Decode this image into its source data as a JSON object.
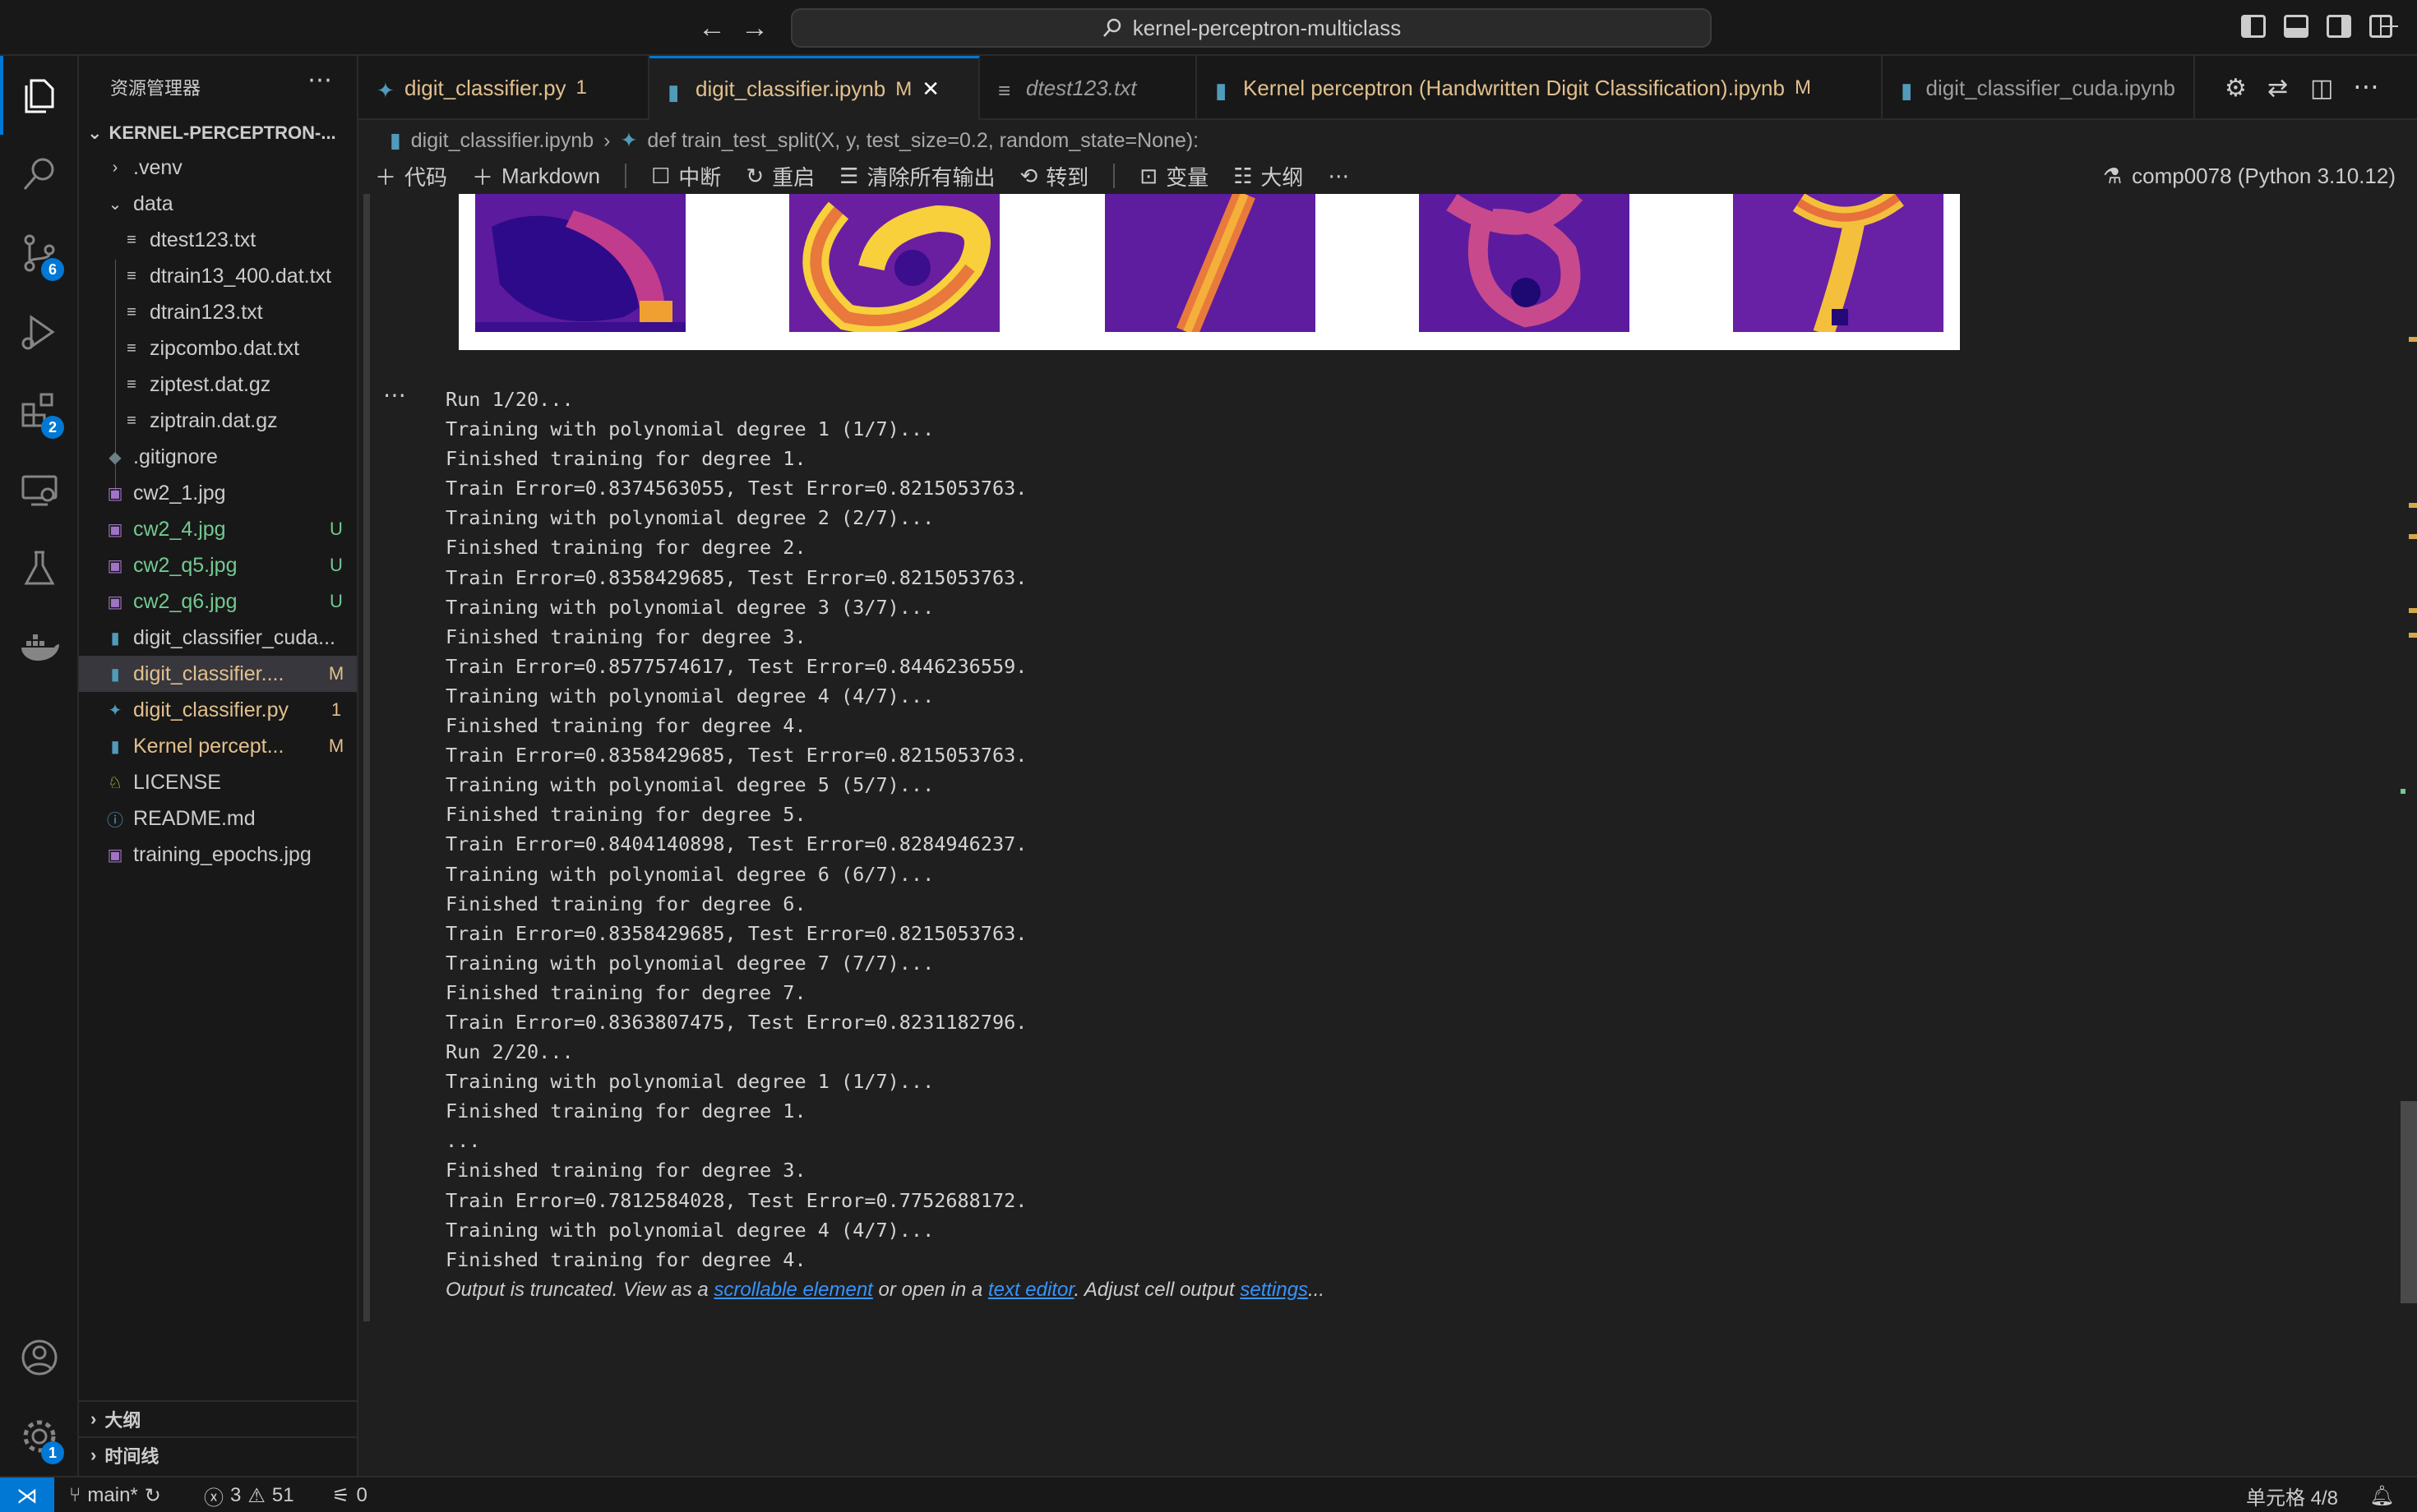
{
  "titlebar": {
    "search_text": "kernel-perceptron-multiclass",
    "back_icon": "arrow-left-icon",
    "forward_icon": "arrow-right-icon"
  },
  "activity": {
    "badges": {
      "scm": "6",
      "extensions": "2",
      "settings": "1"
    }
  },
  "sidebar": {
    "title": "资源管理器",
    "root": "KERNEL-PERCEPTRON-...",
    "items": [
      {
        "label": ".venv",
        "status": ""
      },
      {
        "label": "data",
        "status": ""
      },
      {
        "label": "dtest123.txt",
        "status": ""
      },
      {
        "label": "dtrain13_400.dat.txt",
        "status": ""
      },
      {
        "label": "dtrain123.txt",
        "status": ""
      },
      {
        "label": "zipcombo.dat.txt",
        "status": ""
      },
      {
        "label": "ziptest.dat.gz",
        "status": ""
      },
      {
        "label": "ziptrain.dat.gz",
        "status": ""
      },
      {
        "label": ".gitignore",
        "status": ""
      },
      {
        "label": "cw2_1.jpg",
        "status": ""
      },
      {
        "label": "cw2_4.jpg",
        "status": "U"
      },
      {
        "label": "cw2_q5.jpg",
        "status": "U"
      },
      {
        "label": "cw2_q6.jpg",
        "status": "U"
      },
      {
        "label": "digit_classifier_cuda...",
        "status": ""
      },
      {
        "label": "digit_classifier....",
        "status": "M"
      },
      {
        "label": "digit_classifier.py",
        "status": "1"
      },
      {
        "label": "Kernel percept...",
        "status": "M"
      },
      {
        "label": "LICENSE",
        "status": ""
      },
      {
        "label": "README.md",
        "status": ""
      },
      {
        "label": "training_epochs.jpg",
        "status": ""
      }
    ],
    "outline": "大纲",
    "timeline": "时间线"
  },
  "tabs": [
    {
      "label": "digit_classifier.py",
      "mod": "1"
    },
    {
      "label": "digit_classifier.ipynb",
      "mod": "M"
    },
    {
      "label": "dtest123.txt",
      "mod": ""
    },
    {
      "label": "Kernel perceptron (Handwritten Digit Classification).ipynb",
      "mod": "M"
    },
    {
      "label": "digit_classifier_cuda.ipynb",
      "mod": ""
    }
  ],
  "breadcrumb": {
    "file": "digit_classifier.ipynb",
    "symbol": "def train_test_split(X, y, test_size=0.2, random_state=None):"
  },
  "toolbar": {
    "code": "代码",
    "markdown": "Markdown",
    "interrupt": "中断",
    "restart": "重启",
    "clear": "清除所有输出",
    "goto": "转到",
    "variables": "变量",
    "outline": "大纲",
    "more": "⋯",
    "kernel": "comp0078 (Python 3.10.12)"
  },
  "output": {
    "lines": [
      "Run 1/20...",
      "Training with polynomial degree 1 (1/7)...",
      "Finished training for degree 1.",
      "Train Error=0.8374563055, Test Error=0.8215053763.",
      "Training with polynomial degree 2 (2/7)...",
      "Finished training for degree 2.",
      "Train Error=0.8358429685, Test Error=0.8215053763.",
      "Training with polynomial degree 3 (3/7)...",
      "Finished training for degree 3.",
      "Train Error=0.8577574617, Test Error=0.8446236559.",
      "Training with polynomial degree 4 (4/7)...",
      "Finished training for degree 4.",
      "Train Error=0.8358429685, Test Error=0.8215053763.",
      "Training with polynomial degree 5 (5/7)...",
      "Finished training for degree 5.",
      "Train Error=0.8404140898, Test Error=0.8284946237.",
      "Training with polynomial degree 6 (6/7)...",
      "Finished training for degree 6.",
      "Train Error=0.8358429685, Test Error=0.8215053763.",
      "Training with polynomial degree 7 (7/7)...",
      "Finished training for degree 7.",
      "Train Error=0.8363807475, Test Error=0.8231182796.",
      "Run 2/20...",
      "Training with polynomial degree 1 (1/7)...",
      "Finished training for degree 1.",
      "...",
      "Finished training for degree 3.",
      "Train Error=0.7812584028, Test Error=0.7752688172.",
      "Training with polynomial degree 4 (4/7)...",
      "Finished training for degree 4."
    ],
    "truncated_pre": "Output is truncated. View as a ",
    "truncated_link1": "scrollable element",
    "truncated_mid": " or open in a ",
    "truncated_link2": "text editor",
    "truncated_mid2": ". Adjust cell output ",
    "truncated_link3": "settings",
    "truncated_post": "..."
  },
  "statusbar": {
    "branch": "main*",
    "errors": "3",
    "warnings": "51",
    "ports": "0",
    "cell": "单元格 4/8"
  },
  "colors": {
    "accent": "#0078d4",
    "git_untracked": "#73c991",
    "git_modified": "#e2c08d",
    "link": "#3794ff"
  }
}
